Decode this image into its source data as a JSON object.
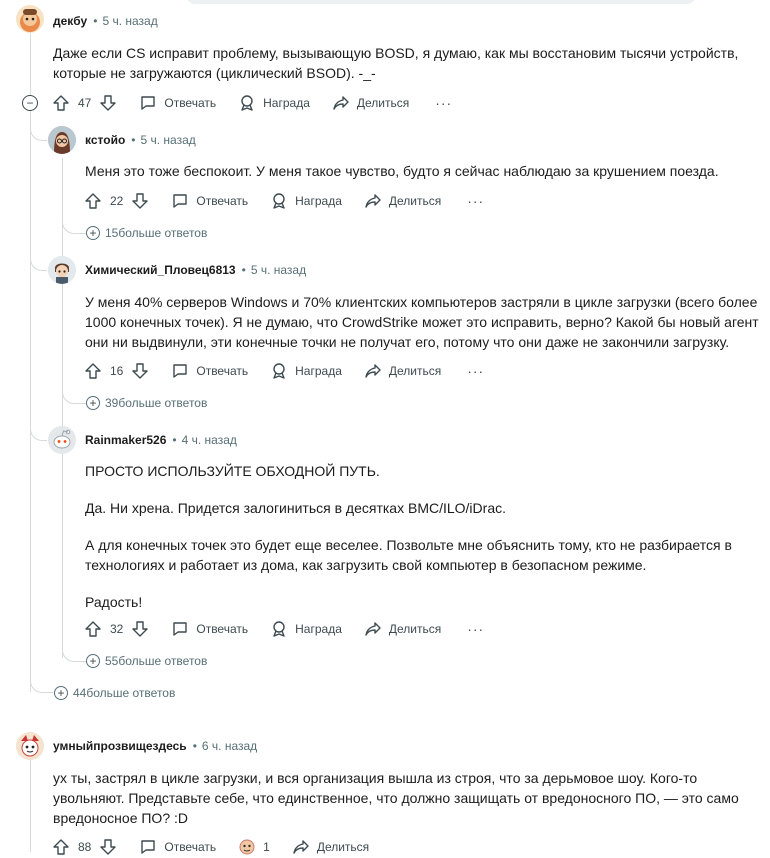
{
  "search_bar": "",
  "comments": [
    {
      "author": "декбу",
      "time": "5 ч. назад",
      "body": [
        "Даже если CS исправит проблему, вызывающую BOSD, я думаю, как мы восстановим тысячи устройств,",
        "которые не загружаются (циклический BSOD). -_-"
      ],
      "votes": "47",
      "reply": "Отвечать",
      "award": "Награда",
      "share": "Делиться",
      "more": "···"
    },
    {
      "author": "кстойо",
      "time": "5 ч. назад",
      "body": [
        "Меня это тоже беспокоит. У меня такое чувство, будто я сейчас наблюдаю за крушением поезда."
      ],
      "votes": "22",
      "reply": "Отвечать",
      "award": "Награда",
      "share": "Делиться",
      "more": "···",
      "more_replies": "15больше ответов"
    },
    {
      "author": "Химический_Пловец6813",
      "time": "5 ч. назад",
      "body": [
        "У меня 40% серверов Windows и 70% клиентских компьютеров застряли в цикле загрузки (всего более",
        "1000 конечных точек). Я не думаю, что CrowdStrike может это исправить, верно? Какой бы новый агент",
        "они ни выдвинули, эти конечные точки не получат его, потому что они даже не закончили загрузку."
      ],
      "votes": "16",
      "reply": "Отвечать",
      "award": "Награда",
      "share": "Делиться",
      "more": "···",
      "more_replies": "39больше ответов"
    },
    {
      "author": "Rainmaker526",
      "time": "4 ч. назад",
      "p1": "ПРОСТО ИСПОЛЬЗУЙТЕ ОБХОДНОЙ ПУТЬ.",
      "p2": "Да. Ни хрена. Придется залогиниться в десятках BMC/ILO/iDrac.",
      "p3": [
        "А для конечных точек это будет еще веселее. Позвольте мне объяснить тому, кто не разбирается в",
        "технологиях и работает из дома, как загрузить свой компьютер в безопасном режиме."
      ],
      "p4": "Радость!",
      "votes": "32",
      "reply": "Отвечать",
      "award": "Награда",
      "share": "Делиться",
      "more": "···",
      "more_replies": "55больше ответов"
    },
    {
      "author": "умныйпрозвищездесь",
      "time": "6 ч. назад",
      "body": [
        "ух ты, застрял в цикле загрузки, и вся организация вышла из строя, что за дерьмовое шоу. Кого-то",
        "увольняют. Представьте себе, что единственное, что должно защищать от вредоносного ПО, — это само",
        "вредоносное ПО? :D"
      ],
      "votes": "88",
      "reply": "Отвечать",
      "award_count": "1",
      "share": "Делиться"
    }
  ],
  "thread_more_replies": "44больше ответов",
  "colors": {
    "text": "#1c1c1c",
    "meta": "#576f76",
    "line": "#d7dadc",
    "icon": "#3d4a4f"
  }
}
